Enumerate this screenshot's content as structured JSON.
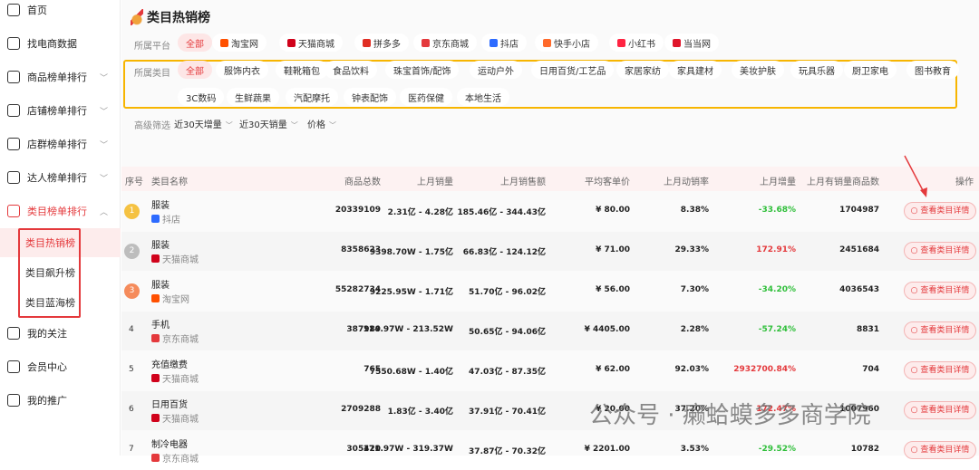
{
  "sidebar": {
    "items": [
      {
        "label": "首页"
      },
      {
        "label": "找电商数据"
      },
      {
        "label": "商品榜单排行"
      },
      {
        "label": "店铺榜单排行"
      },
      {
        "label": "店群榜单排行"
      },
      {
        "label": "达人榜单排行"
      },
      {
        "label": "类目榜单排行"
      }
    ],
    "sub": [
      "类目热销榜",
      "类目飙升榜",
      "类目蓝海榜"
    ],
    "bottom": [
      {
        "label": "我的关注"
      },
      {
        "label": "会员中心"
      },
      {
        "label": "我的推广"
      }
    ]
  },
  "page": {
    "title": "类目热销榜"
  },
  "filters": {
    "platform_label": "所属平台",
    "platforms": [
      "全部",
      "淘宝网",
      "天猫商城",
      "拼多多",
      "京东商城",
      "抖店",
      "快手小店",
      "小红书",
      "当当网"
    ],
    "category_label": "所属类目",
    "categories": [
      "全部",
      "服饰内衣",
      "鞋靴箱包",
      "食品饮料",
      "珠宝首饰/配饰",
      "运动户外",
      "日用百货/工艺品",
      "家居家纺",
      "家具建材",
      "美妆护肤",
      "玩具乐器",
      "厨卫家电",
      "图书教育",
      "3C数码",
      "生鲜蔬果",
      "汽配摩托",
      "钟表配饰",
      "医药保健",
      "本地生活"
    ],
    "advanced_label": "高级筛选",
    "advanced": [
      "近30天增量",
      "近30天销量",
      "价格"
    ]
  },
  "colors": {
    "accent": "#e4393c",
    "positive": "#e4393c",
    "negative": "#2fbf3a",
    "highlight": "#f7b500"
  },
  "table": {
    "headers": [
      "序号",
      "类目名称",
      "商品总数",
      "上月销量",
      "上月销售额",
      "平均客单价",
      "上月动销率",
      "上月增量",
      "上月有销量商品数",
      "操作"
    ],
    "action_label": "查看类目详情",
    "rows": [
      {
        "rank": "1",
        "name": "服装",
        "platform": "抖店",
        "total": "20339109",
        "sales": "2.31亿 - 4.28亿",
        "revenue": "185.46亿 - 344.43亿",
        "avg": "¥ 80.00",
        "rate": "8.38%",
        "growth": "-33.68%",
        "sold": "1704987"
      },
      {
        "rank": "2",
        "name": "服装",
        "platform": "天猫商城",
        "total": "8358623",
        "sales": "9398.70W - 1.75亿",
        "revenue": "66.83亿 - 124.12亿",
        "avg": "¥ 71.00",
        "rate": "29.33%",
        "growth": "172.91%",
        "sold": "2451684"
      },
      {
        "rank": "3",
        "name": "服装",
        "platform": "淘宝网",
        "total": "55282734",
        "sales": "9225.95W - 1.71亿",
        "revenue": "51.70亿 - 96.02亿",
        "avg": "¥ 56.00",
        "rate": "7.30%",
        "growth": "-34.20%",
        "sold": "4036543"
      },
      {
        "rank": "4",
        "name": "手机",
        "platform": "京东商城",
        "total": "387989",
        "sales": "114.97W - 213.52W",
        "revenue": "50.65亿 - 94.06亿",
        "avg": "¥ 4405.00",
        "rate": "2.28%",
        "growth": "-57.24%",
        "sold": "8831"
      },
      {
        "rank": "5",
        "name": "充值缴费",
        "platform": "天猫商城",
        "total": "765",
        "sales": "7550.68W - 1.40亿",
        "revenue": "47.03亿 - 87.35亿",
        "avg": "¥ 62.00",
        "rate": "92.03%",
        "growth": "2932700.84%",
        "sold": "704"
      },
      {
        "rank": "6",
        "name": "日用百货",
        "platform": "天猫商城",
        "total": "2709288",
        "sales": "1.83亿 - 3.40亿",
        "revenue": "37.91亿 - 70.41亿",
        "avg": "¥ 20.00",
        "rate": "37.20%",
        "growth": "172.47%",
        "sold": "1007960"
      },
      {
        "rank": "7",
        "name": "制冷电器",
        "platform": "京东商城",
        "total": "305420",
        "sales": "171.97W - 319.37W",
        "revenue": "37.87亿 - 70.32亿",
        "avg": "¥ 2201.00",
        "rate": "3.53%",
        "growth": "-29.52%",
        "sold": "10782"
      }
    ]
  },
  "watermark": "公众号 · 癞蛤蟆多多商学院"
}
